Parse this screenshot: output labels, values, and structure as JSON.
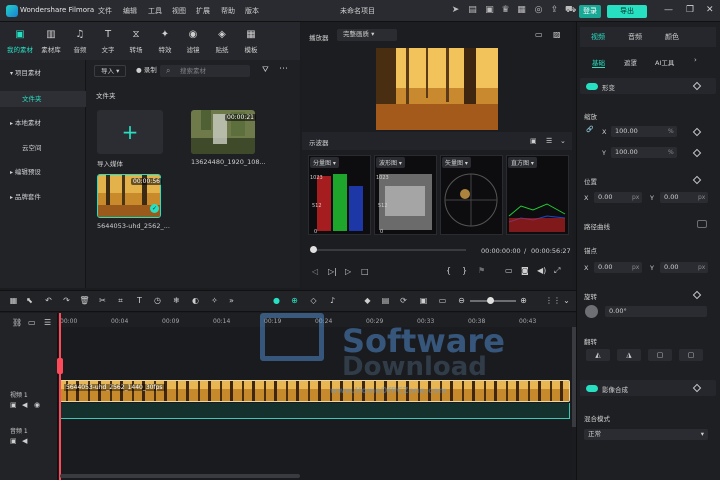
{
  "app": {
    "title": "Wondershare Filmora",
    "project": "未命名项目",
    "menu": [
      "文件",
      "编辑",
      "工具",
      "视图",
      "扩展",
      "帮助",
      "版本"
    ],
    "login": "登录",
    "export": "导出"
  },
  "media_tabs": [
    {
      "label": "我的素材",
      "icon": "folder-icon"
    },
    {
      "label": "素材库",
      "icon": "library-icon"
    },
    {
      "label": "音频",
      "icon": "music-icon"
    },
    {
      "label": "文字",
      "icon": "text-icon"
    },
    {
      "label": "转场",
      "icon": "transition-icon"
    },
    {
      "label": "特效",
      "icon": "effects-icon"
    },
    {
      "label": "滤镜",
      "icon": "filter-icon"
    },
    {
      "label": "贴纸",
      "icon": "sticker-icon"
    },
    {
      "label": "模板",
      "icon": "template-icon"
    }
  ],
  "left_nav": [
    {
      "label": "项目素材"
    },
    {
      "label": "文件夹"
    },
    {
      "label": "本地素材"
    },
    {
      "label": "云空间"
    },
    {
      "label": "编辑预设"
    },
    {
      "label": "品牌套件"
    }
  ],
  "media": {
    "import_chip": "导入",
    "record_chip": "录制",
    "search_placeholder": "搜索素材",
    "folder_label": "文件夹",
    "import_label": "导入媒体",
    "items": [
      {
        "name": "13624480_1920_108...",
        "duration": "00:00:21"
      },
      {
        "name": "5644053-uhd_2562_...",
        "duration": "00:00:56"
      }
    ]
  },
  "player": {
    "label": "播放器",
    "quality": "完整画质",
    "scope_title": "示波器",
    "scopes": [
      "分量图",
      "波形图",
      "矢量图",
      "直方图"
    ],
    "scope_marks": [
      "1023",
      "512",
      "0"
    ],
    "time_current": "00:00:00:00",
    "time_total": "00:00:56:27",
    "time_sep": "/"
  },
  "right_panel": {
    "tabs": [
      "视频",
      "音频",
      "颜色"
    ],
    "subtabs": [
      "基础",
      "遮罩",
      "AI工具"
    ],
    "transform": "形变",
    "scale": "缩放",
    "x_label": "X",
    "y_label": "Y",
    "scale_x": "100.00",
    "scale_y": "100.00",
    "percent": "%",
    "position": "位置",
    "pos_x": "0.00",
    "pos_y": "0.00",
    "px": "px",
    "path_curve": "路径曲线",
    "anchor": "锚点",
    "anchor_x": "0.00",
    "anchor_y": "0.00",
    "rotate": "旋转",
    "rotate_val": "0.00°",
    "flip": "翻转",
    "compositing": "影像合成",
    "blend_mode": "混合模式",
    "blend_value": "正常"
  },
  "timeline": {
    "ticks": [
      "00:00",
      "00:04",
      "00:09",
      "00:14",
      "00:19",
      "00:24",
      "00:29",
      "00:33",
      "00:38",
      "00:43"
    ],
    "video_track": "视频 1",
    "audio_track": "音频 1",
    "clip_name": "5644053-uhd_2562_1440_30fps"
  },
  "watermark": {
    "line1": "Software",
    "line2": "Download",
    "small": "www.HomeOfPCZone.com"
  }
}
